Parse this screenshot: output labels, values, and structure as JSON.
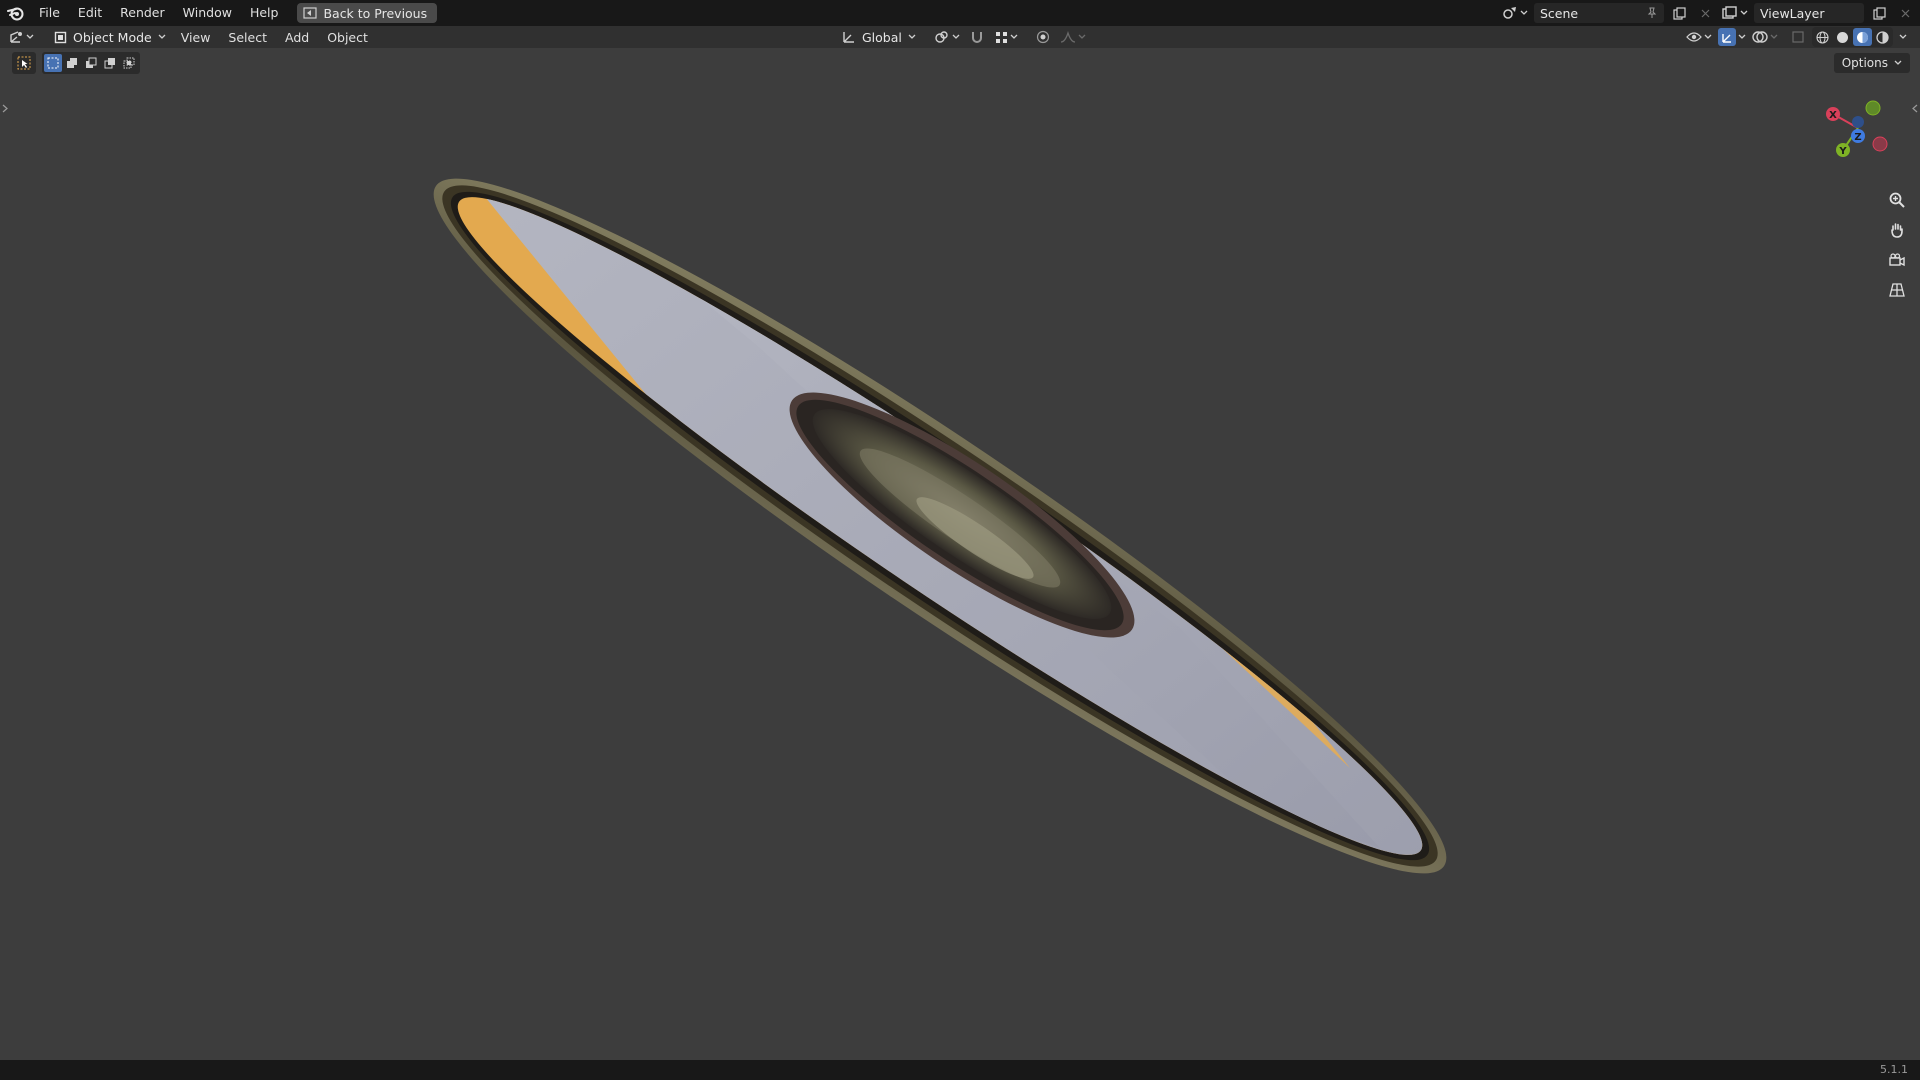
{
  "topbar": {
    "menus": [
      "File",
      "Edit",
      "Render",
      "Window",
      "Help"
    ],
    "back_label": "Back to Previous",
    "scene": "Scene",
    "view_layer": "ViewLayer"
  },
  "header": {
    "mode": "Object Mode",
    "menus": [
      "View",
      "Select",
      "Add",
      "Object"
    ],
    "transform_orientation": "Global",
    "shading_active": "material-preview"
  },
  "viewport": {
    "options_label": "Options",
    "gizmo_axes": {
      "x": "X",
      "y": "Y",
      "z": "Z"
    },
    "object": "disc-with-reflective-rim",
    "colors": {
      "background": "#3d3d3d",
      "disc_orange": "#e3a94f",
      "disc_grey": "#a8aab8",
      "rim": "#6b6347"
    }
  },
  "status": {
    "version": "5.1.1"
  }
}
